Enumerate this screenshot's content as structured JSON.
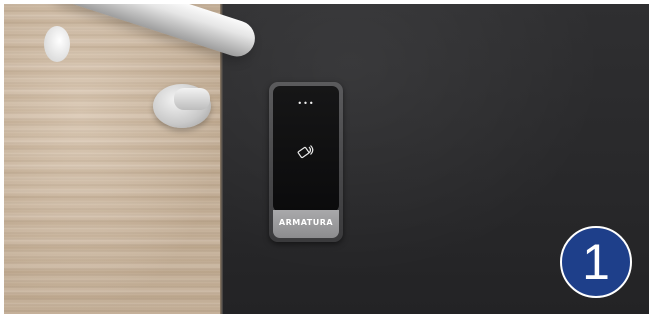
{
  "reader": {
    "brand": "ARMATURA",
    "indicator_lights": "•••",
    "icon": "card-contactless-icon"
  },
  "badge": {
    "number": "1",
    "color": "#1e3f8a"
  },
  "colors": {
    "wall": "#2a2a2b",
    "wood": "#d7c3ac"
  }
}
